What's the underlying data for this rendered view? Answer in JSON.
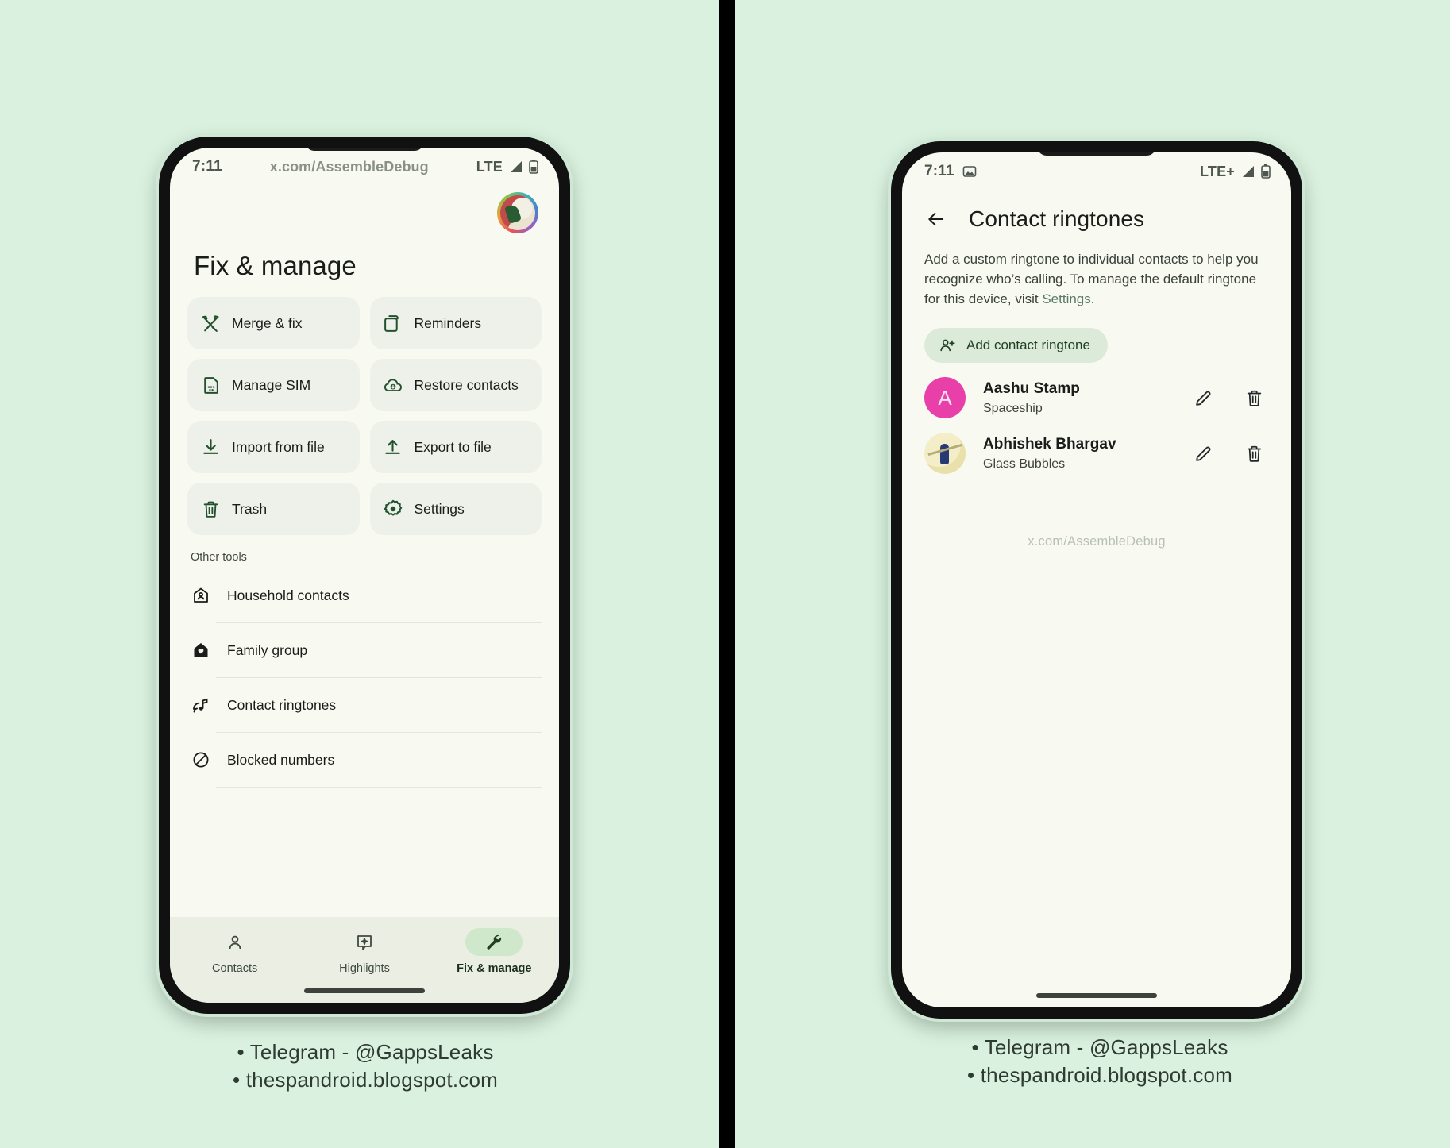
{
  "page": {
    "background_color": "#d9f1de",
    "divider_color": "#000000"
  },
  "left_phone": {
    "status_bar": {
      "time": "7:11",
      "center_text": "x.com/AssembleDebug",
      "network": "LTE",
      "signal_icon": "signal-triangle-icon",
      "battery_icon": "battery-icon"
    },
    "avatar": {
      "icon": "profile-avatar"
    },
    "title": "Fix & manage",
    "tiles": [
      {
        "label": "Merge & fix",
        "icon": "merge-tools-icon"
      },
      {
        "label": "Reminders",
        "icon": "reminders-stack-icon"
      },
      {
        "label": "Manage SIM",
        "icon": "sim-card-icon"
      },
      {
        "label": "Restore contacts",
        "icon": "cloud-restore-icon"
      },
      {
        "label": "Import from file",
        "icon": "download-icon"
      },
      {
        "label": "Export to file",
        "icon": "upload-icon"
      },
      {
        "label": "Trash",
        "icon": "trash-icon"
      },
      {
        "label": "Settings",
        "icon": "gear-icon"
      }
    ],
    "other_tools_label": "Other tools",
    "other_tools": [
      {
        "label": "Household contacts",
        "icon": "household-icon"
      },
      {
        "label": "Family group",
        "icon": "family-home-heart-icon"
      },
      {
        "label": "Contact ringtones",
        "icon": "ringtone-note-icon"
      },
      {
        "label": "Blocked numbers",
        "icon": "block-circle-icon"
      }
    ],
    "nav": [
      {
        "label": "Contacts",
        "icon": "person-icon",
        "active": false
      },
      {
        "label": "Highlights",
        "icon": "sparkle-card-icon",
        "active": false
      },
      {
        "label": "Fix & manage",
        "icon": "wrench-icon",
        "active": true
      }
    ],
    "accent_color": "#23512f",
    "nav_active_pill_color": "#cfe7cb"
  },
  "right_phone": {
    "status_bar": {
      "time": "7:11",
      "screenshot_icon": "image-icon",
      "network": "LTE+",
      "signal_icon": "signal-triangle-icon",
      "battery_icon": "battery-icon"
    },
    "back_icon": "back-arrow-icon",
    "title": "Contact ringtones",
    "description_part1": "Add a custom ringtone to individual contacts to help you recognize who’s calling. To manage the default ringtone for this device, visit ",
    "description_link": "Settings",
    "description_part2": ".",
    "add_button": {
      "label": "Add contact ringtone",
      "icon": "person-add-icon"
    },
    "contacts": [
      {
        "name": "Aashu Stamp",
        "ringtone": "Spaceship",
        "avatar_type": "letter",
        "avatar_letter": "A",
        "avatar_color": "#e83fa8",
        "edit_icon": "pencil-icon",
        "delete_icon": "trash-icon"
      },
      {
        "name": "Abhishek Bhargav",
        "ringtone": "Glass Bubbles",
        "avatar_type": "photo",
        "avatar_letter": "",
        "avatar_color": "#efe7bb",
        "edit_icon": "pencil-icon",
        "delete_icon": "trash-icon"
      }
    ],
    "watermark": "x.com/AssembleDebug"
  },
  "captions": {
    "left_line1": "• Telegram - @GappsLeaks",
    "left_line2": "• thespandroid.blogspot.com",
    "right_line1": "• Telegram - @GappsLeaks",
    "right_line2": "• thespandroid.blogspot.com"
  }
}
